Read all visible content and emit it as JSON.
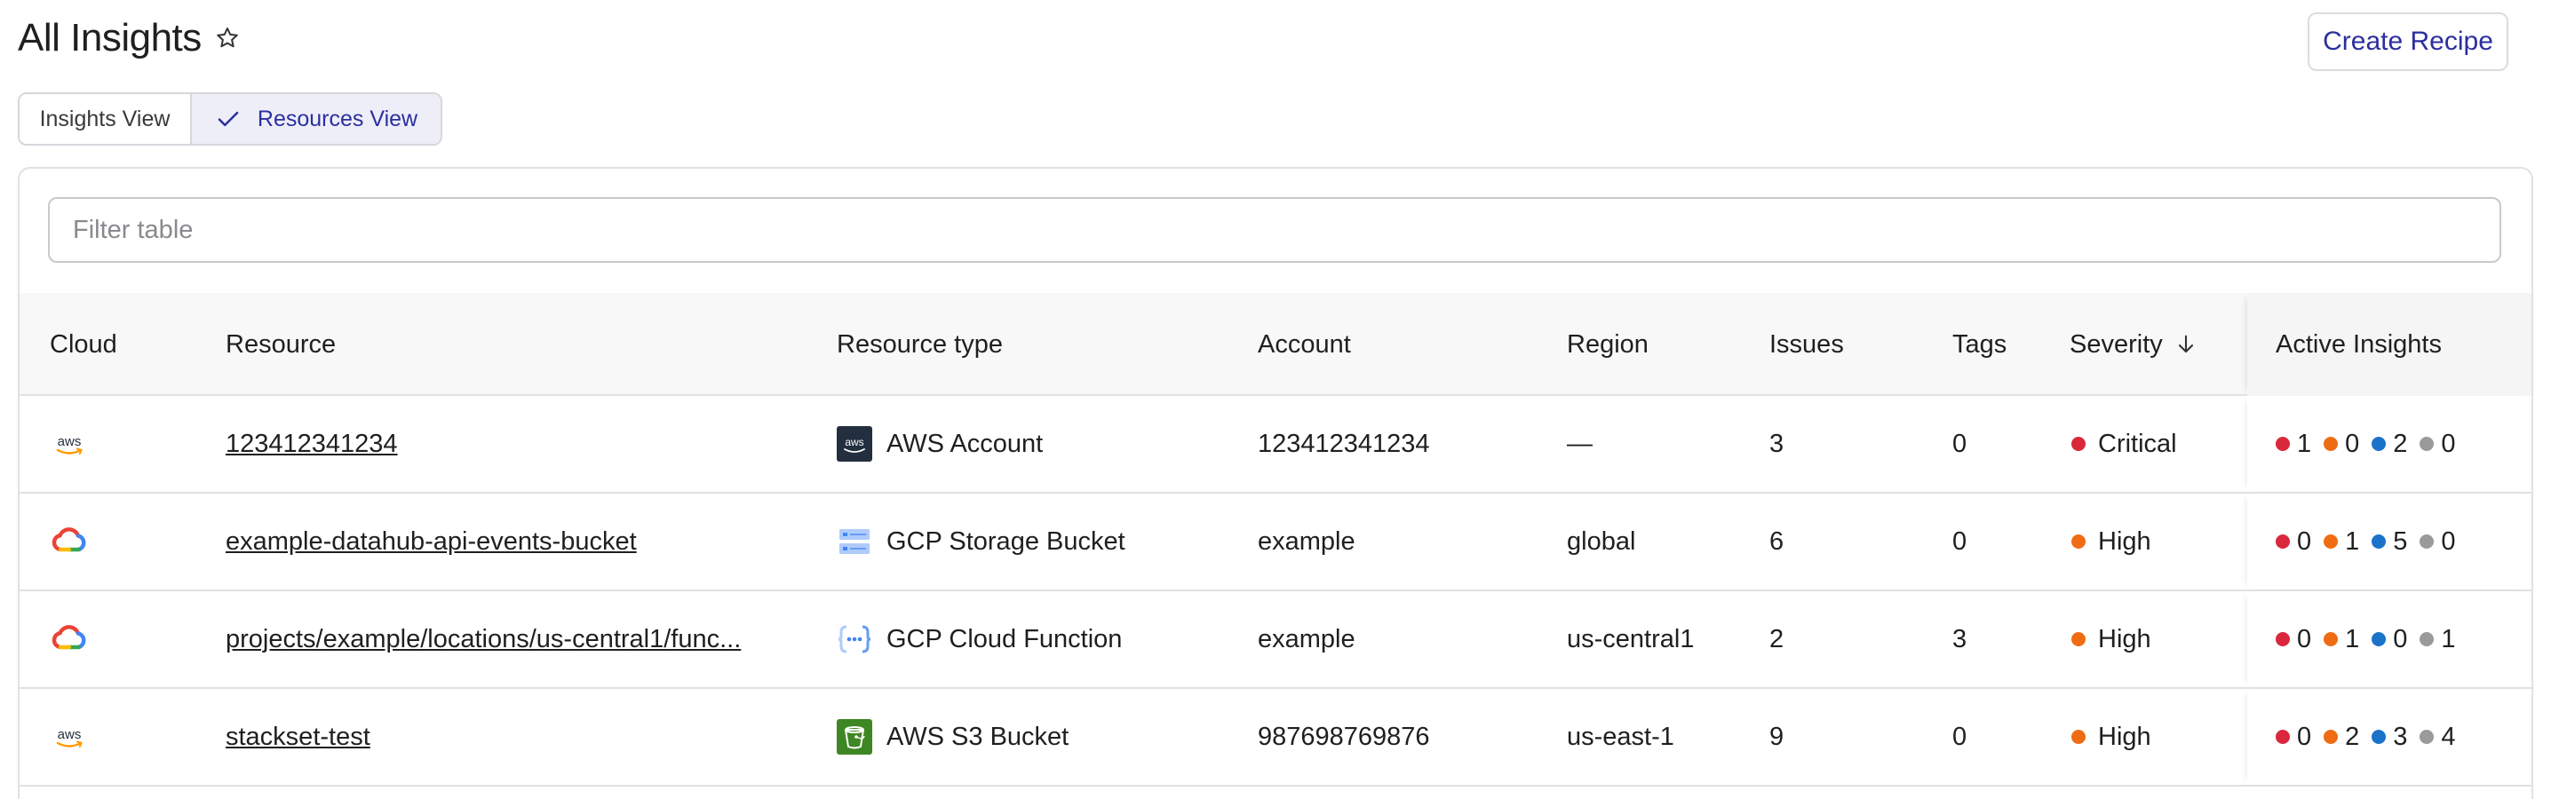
{
  "header": {
    "title": "All Insights",
    "create_label": "Create Recipe"
  },
  "view_toggle": {
    "insights_label": "Insights View",
    "resources_label": "Resources View",
    "selected": "Resources View"
  },
  "filter": {
    "placeholder": "Filter table",
    "value": ""
  },
  "table": {
    "columns": {
      "cloud": "Cloud",
      "resource": "Resource",
      "resource_type": "Resource type",
      "account": "Account",
      "region": "Region",
      "issues": "Issues",
      "tags": "Tags",
      "severity": "Severity",
      "active_insights": "Active Insights"
    },
    "sort": {
      "column": "Severity",
      "direction": "descending"
    },
    "rows": [
      {
        "cloud_icon": "aws-logo-icon",
        "resource": "123412341234",
        "resource_type": "AWS Account",
        "resource_type_icon": "aws-account-icon",
        "account": "123412341234",
        "region": "—",
        "issues": "3",
        "tags": "0",
        "severity": "Critical",
        "severity_color": "#d9283c",
        "insights": {
          "critical": "1",
          "high": "0",
          "medium": "2",
          "low": "0"
        }
      },
      {
        "cloud_icon": "gcp-logo-icon",
        "resource": "example-datahub-api-events-bucket",
        "resource_type": "GCP Storage Bucket",
        "resource_type_icon": "gcp-storage-bucket-icon",
        "account": "example",
        "region": "global",
        "issues": "6",
        "tags": "0",
        "severity": "High",
        "severity_color": "#ef6c13",
        "insights": {
          "critical": "0",
          "high": "1",
          "medium": "5",
          "low": "0"
        }
      },
      {
        "cloud_icon": "gcp-logo-icon",
        "resource": "projects/example/locations/us-central1/func...",
        "resource_type": "GCP Cloud Function",
        "resource_type_icon": "gcp-cloud-function-icon",
        "account": "example",
        "region": "us-central1",
        "issues": "2",
        "tags": "3",
        "severity": "High",
        "severity_color": "#ef6c13",
        "insights": {
          "critical": "0",
          "high": "1",
          "medium": "0",
          "low": "1"
        }
      },
      {
        "cloud_icon": "aws-logo-icon",
        "resource": "stackset-test",
        "resource_type": "AWS S3 Bucket",
        "resource_type_icon": "aws-s3-bucket-icon",
        "account": "987698769876",
        "region": "us-east-1",
        "issues": "9",
        "tags": "0",
        "severity": "High",
        "severity_color": "#ef6c13",
        "insights": {
          "critical": "0",
          "high": "2",
          "medium": "3",
          "low": "4"
        }
      }
    ]
  },
  "colors": {
    "accent": "#2b2f9e",
    "critical": "#d9283c",
    "high": "#ef6c13",
    "medium": "#1a73c8",
    "low": "#9a9a9a"
  }
}
